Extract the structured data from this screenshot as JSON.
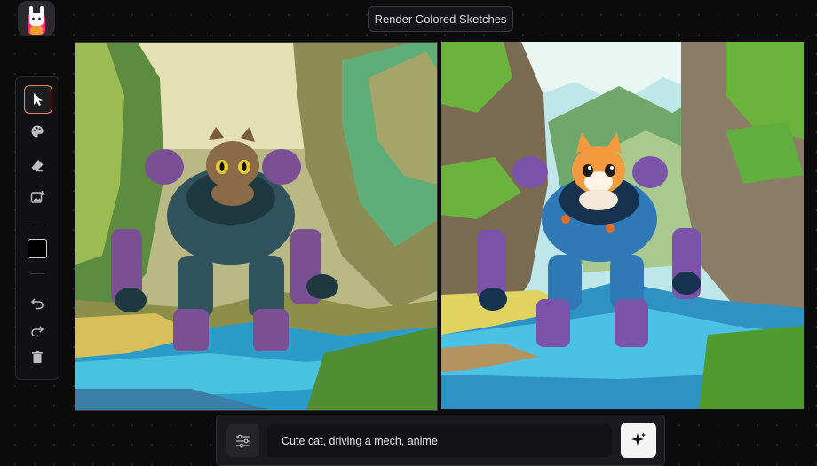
{
  "app": {
    "title": "Render Colored Sketches",
    "logo_icon": "llama-logo-icon"
  },
  "toolbar": {
    "tools": [
      {
        "name": "select",
        "icon": "cursor-arrow-icon",
        "active": true
      },
      {
        "name": "color",
        "icon": "palette-icon"
      },
      {
        "name": "erase",
        "icon": "eraser-icon"
      },
      {
        "name": "image",
        "icon": "image-add-icon"
      }
    ],
    "color_swatch": "#000000",
    "actions": [
      {
        "name": "undo",
        "icon": "undo-icon"
      },
      {
        "name": "redo",
        "icon": "redo-icon"
      },
      {
        "name": "delete",
        "icon": "trash-icon"
      }
    ]
  },
  "canvases": {
    "sketch": {
      "kind": "colored-sketch"
    },
    "render": {
      "kind": "rendered-image"
    }
  },
  "prompt": {
    "value": "Cute cat, driving a mech, anime",
    "settings_icon": "sliders-icon",
    "generate_icon": "sparkle-icon"
  }
}
